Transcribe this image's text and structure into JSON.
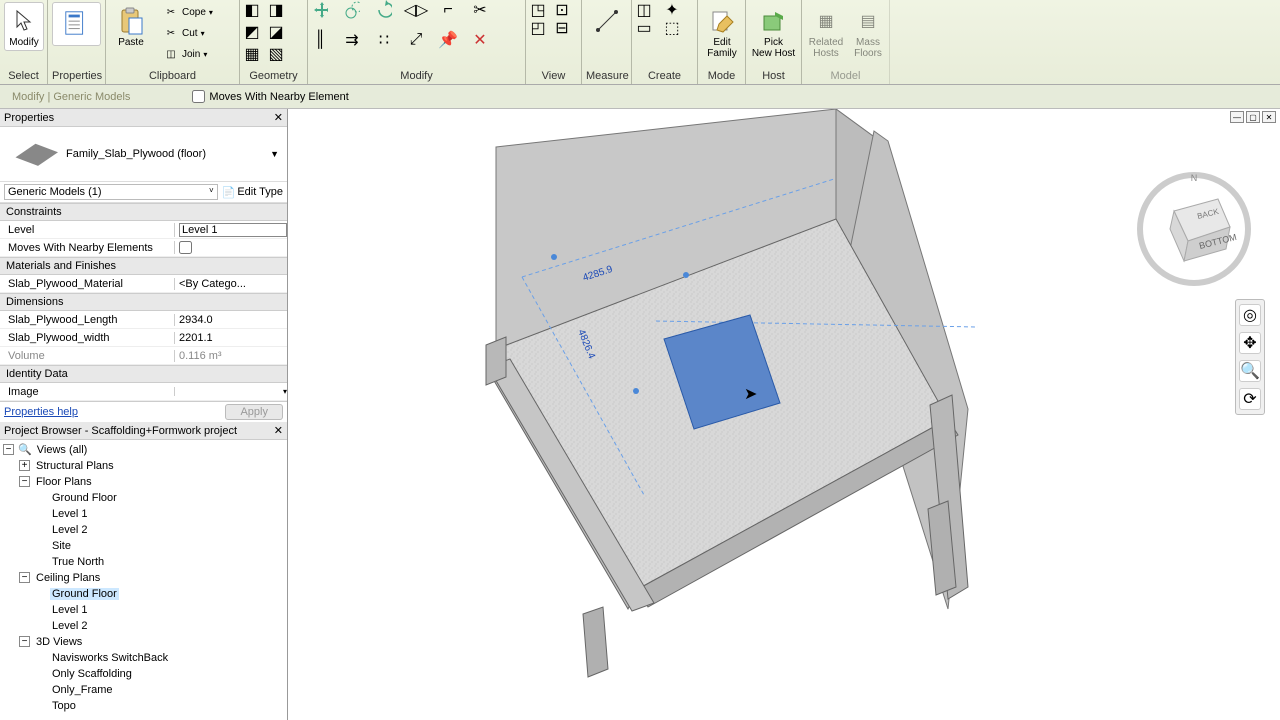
{
  "ribbon": {
    "groups": {
      "select": {
        "label": "Select",
        "modify": "Modify"
      },
      "properties": {
        "label": "Properties",
        "btn": ""
      },
      "clipboard": {
        "label": "Clipboard",
        "paste": "Paste"
      },
      "clip_small": {
        "cope": "Cope",
        "cut": "Cut",
        "join": "Join"
      },
      "geometry": {
        "label": "Geometry"
      },
      "modify": {
        "label": "Modify"
      },
      "view": {
        "label": "View"
      },
      "measure": {
        "label": "Measure"
      },
      "create": {
        "label": "Create"
      },
      "mode": {
        "label": "Mode",
        "edit_family": "Edit\nFamily"
      },
      "host": {
        "label": "Host",
        "pick_new_host": "Pick\nNew Host"
      },
      "model": {
        "label": "Model",
        "related_hosts": "Related\nHosts",
        "mass_floors": "Mass\nFloors"
      }
    }
  },
  "optbar": {
    "modelabel": "Modify | Generic Models",
    "checkbox": "Moves With Nearby Element"
  },
  "properties": {
    "title": "Properties",
    "type_name": "Family_Slab_Plywood (floor)",
    "filter": "Generic Models (1)",
    "edit_type": "Edit Type",
    "sections": {
      "constraints": {
        "hdr": "Constraints",
        "level_k": "Level",
        "level_v": "Level 1",
        "moves_k": "Moves With Nearby Elements"
      },
      "matfin": {
        "hdr": "Materials and Finishes",
        "mat_k": "Slab_Plywood_Material",
        "mat_v": "<By Catego..."
      },
      "dims": {
        "hdr": "Dimensions",
        "len_k": "Slab_Plywood_Length",
        "len_v": "2934.0",
        "wid_k": "Slab_Plywood_width",
        "wid_v": "2201.1",
        "vol_k": "Volume",
        "vol_v": "0.116 m³"
      },
      "ident": {
        "hdr": "Identity Data",
        "img_k": "Image"
      }
    },
    "help": "Properties help",
    "apply": "Apply"
  },
  "browser": {
    "title": "Project Browser - Scaffolding+Formwork project",
    "root": "Views (all)",
    "items": {
      "structural": "Structural Plans",
      "floor": "Floor Plans",
      "floor_children": [
        "Ground Floor",
        "Level 1",
        "Level 2",
        "Site",
        "True North"
      ],
      "ceiling": "Ceiling Plans",
      "ceiling_children": [
        "Ground Floor",
        "Level 1",
        "Level 2"
      ],
      "views3d": "3D Views",
      "views3d_children": [
        "Navisworks SwitchBack",
        "Only Scaffolding",
        "Only_Frame",
        "Topo"
      ]
    }
  },
  "viewport": {
    "dims": {
      "run": "4285.9",
      "rise": "4826.4"
    },
    "cube": "BOTTOM",
    "cube2": "BACK"
  }
}
